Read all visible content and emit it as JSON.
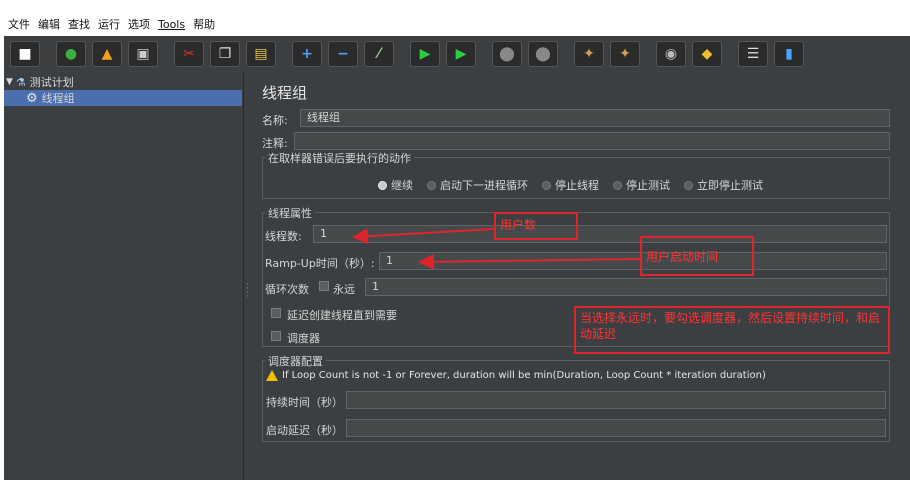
{
  "menu": [
    "文件",
    "编辑",
    "查找",
    "运行",
    "选项",
    "Tools",
    "帮助"
  ],
  "toolbar": [
    {
      "icon": "new-icon",
      "glyph": "■",
      "color": "#ffffff"
    },
    {
      "icon": "templates-icon",
      "glyph": "●",
      "color": "#3cb043"
    },
    {
      "icon": "open-icon",
      "glyph": "▲",
      "color": "#f0a020"
    },
    {
      "icon": "save-icon",
      "glyph": "▣",
      "color": "#cccccc"
    },
    {
      "icon": "cut-icon",
      "glyph": "✂",
      "color": "#e03030"
    },
    {
      "icon": "copy-icon",
      "glyph": "❐",
      "color": "#dddddd"
    },
    {
      "icon": "paste-icon",
      "glyph": "▤",
      "color": "#e8c050"
    },
    {
      "icon": "expand-icon",
      "glyph": "+",
      "color": "#4aa3ff"
    },
    {
      "icon": "collapse-icon",
      "glyph": "−",
      "color": "#4aa3ff"
    },
    {
      "icon": "toggle-icon",
      "glyph": "⁄",
      "color": "#88cc88"
    },
    {
      "icon": "start-icon",
      "glyph": "▶",
      "color": "#2ecc40"
    },
    {
      "icon": "start-no-pause-icon",
      "glyph": "▶",
      "color": "#2ecc40"
    },
    {
      "icon": "stop-icon",
      "glyph": "⬤",
      "color": "#888888"
    },
    {
      "icon": "shutdown-icon",
      "glyph": "⬤",
      "color": "#888888"
    },
    {
      "icon": "clear-icon",
      "glyph": "✦",
      "color": "#d0a050"
    },
    {
      "icon": "clear-all-icon",
      "glyph": "✦",
      "color": "#d0a050"
    },
    {
      "icon": "search-icon",
      "glyph": "◉",
      "color": "#bbbbbb"
    },
    {
      "icon": "reset-search-icon",
      "glyph": "◆",
      "color": "#f0c030"
    },
    {
      "icon": "function-helper-icon",
      "glyph": "☰",
      "color": "#dddddd"
    },
    {
      "icon": "help-icon",
      "glyph": "▮",
      "color": "#4aa3ff"
    }
  ],
  "tree": {
    "root_label": "测试计划",
    "child_label": "线程组"
  },
  "panel": {
    "title": "线程组",
    "name_label": "名称:",
    "name_value": "线程组",
    "comment_label": "注释:",
    "comment_value": "",
    "error_action": {
      "legend": "在取样器错误后要执行的动作",
      "options": [
        {
          "label": "继续",
          "selected": true
        },
        {
          "label": "启动下一进程循环",
          "selected": false
        },
        {
          "label": "停止线程",
          "selected": false
        },
        {
          "label": "停止测试",
          "selected": false
        },
        {
          "label": "立即停止测试",
          "selected": false
        }
      ]
    },
    "thread_props": {
      "legend": "线程属性",
      "threads_label": "线程数:",
      "threads_value": "1",
      "rampup_label": "Ramp-Up时间（秒）:",
      "rampup_value": "1",
      "loop_label": "循环次数",
      "forever_label": "永远",
      "loop_value": "1",
      "delay_label": "延迟创建线程直到需要",
      "scheduler_label": "调度器"
    },
    "scheduler_config": {
      "legend": "调度器配置",
      "warning": "If Loop Count is not -1 or Forever, duration will be min(Duration, Loop Count * iteration duration)",
      "duration_label": "持续时间（秒）",
      "duration_value": "",
      "startup_delay_label": "启动延迟（秒）",
      "startup_delay_value": ""
    }
  },
  "annotations": {
    "users": "用户数",
    "rampup": "用户启动时间",
    "note": "当选择永远时，要勾选调度器，然后设置持续时间，和启动延迟"
  },
  "colors": {
    "annotation": "#e0242b",
    "background": "#3c3f41",
    "selection": "#4b6eaf"
  }
}
